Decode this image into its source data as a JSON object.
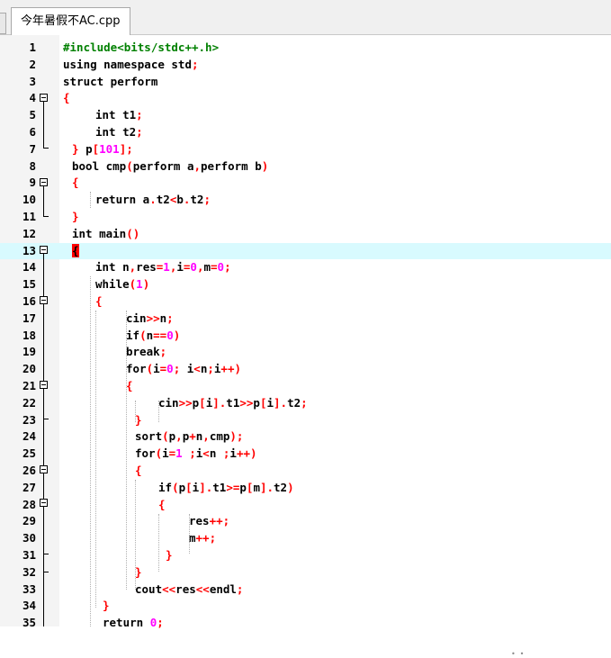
{
  "tab": {
    "title": "今年暑假不AC.cpp"
  },
  "editor": {
    "current_line": 13,
    "lines": [
      {
        "n": "1",
        "indent": 0,
        "tokens": [
          [
            "pp",
            "#include<bits/stdc++.h>"
          ]
        ]
      },
      {
        "n": "2",
        "indent": 0,
        "tokens": [
          [
            "kw",
            "using namespace std"
          ],
          [
            "op",
            ";"
          ]
        ]
      },
      {
        "n": "3",
        "indent": 0,
        "tokens": [
          [
            "kw",
            "struct perform"
          ]
        ]
      },
      {
        "n": "4",
        "indent": 0,
        "tokens": [
          [
            "op",
            "{"
          ]
        ]
      },
      {
        "n": "5",
        "indent": 36,
        "tokens": [
          [
            "kw",
            "int t1"
          ],
          [
            "op",
            ";"
          ]
        ]
      },
      {
        "n": "6",
        "indent": 36,
        "tokens": [
          [
            "kw",
            "int t2"
          ],
          [
            "op",
            ";"
          ]
        ]
      },
      {
        "n": "7",
        "indent": 10,
        "tokens": [
          [
            "op",
            "} "
          ],
          [
            "kw",
            "p"
          ],
          [
            "op",
            "["
          ],
          [
            "num",
            "101"
          ],
          [
            "op",
            "];"
          ]
        ]
      },
      {
        "n": "8",
        "indent": 10,
        "tokens": [
          [
            "kw",
            "bool cmp"
          ],
          [
            "op",
            "("
          ],
          [
            "kw",
            "perform a"
          ],
          [
            "op",
            ","
          ],
          [
            "kw",
            "perform b"
          ],
          [
            "op",
            ")"
          ]
        ]
      },
      {
        "n": "9",
        "indent": 10,
        "tokens": [
          [
            "op",
            "{"
          ]
        ]
      },
      {
        "n": "10",
        "indent": 36,
        "tokens": [
          [
            "kw",
            "return a"
          ],
          [
            "op",
            "."
          ],
          [
            "kw",
            "t2"
          ],
          [
            "op",
            "<"
          ],
          [
            "kw",
            "b"
          ],
          [
            "op",
            "."
          ],
          [
            "kw",
            "t2"
          ],
          [
            "op",
            ";"
          ]
        ]
      },
      {
        "n": "11",
        "indent": 10,
        "tokens": [
          [
            "op",
            "}"
          ]
        ]
      },
      {
        "n": "12",
        "indent": 10,
        "tokens": [
          [
            "kw",
            "int main"
          ],
          [
            "op",
            "()"
          ]
        ]
      },
      {
        "n": "13",
        "indent": 10,
        "tokens": [
          [
            "cur",
            "{"
          ]
        ]
      },
      {
        "n": "14",
        "indent": 36,
        "tokens": [
          [
            "kw",
            "int n"
          ],
          [
            "op",
            ","
          ],
          [
            "kw",
            "res"
          ],
          [
            "op",
            "="
          ],
          [
            "num",
            "1"
          ],
          [
            "op",
            ","
          ],
          [
            "kw",
            "i"
          ],
          [
            "op",
            "="
          ],
          [
            "num",
            "0"
          ],
          [
            "op",
            ","
          ],
          [
            "kw",
            "m"
          ],
          [
            "op",
            "="
          ],
          [
            "num",
            "0"
          ],
          [
            "op",
            ";"
          ]
        ]
      },
      {
        "n": "15",
        "indent": 36,
        "tokens": [
          [
            "kw",
            "while"
          ],
          [
            "op",
            "("
          ],
          [
            "num",
            "1"
          ],
          [
            "op",
            ")"
          ]
        ]
      },
      {
        "n": "16",
        "indent": 36,
        "tokens": [
          [
            "op",
            "{"
          ]
        ]
      },
      {
        "n": "17",
        "indent": 70,
        "tokens": [
          [
            "kw",
            "cin"
          ],
          [
            "op",
            ">>"
          ],
          [
            "kw",
            "n"
          ],
          [
            "op",
            ";"
          ]
        ]
      },
      {
        "n": "18",
        "indent": 70,
        "tokens": [
          [
            "kw",
            "if"
          ],
          [
            "op",
            "("
          ],
          [
            "kw",
            "n"
          ],
          [
            "op",
            "=="
          ],
          [
            "num",
            "0"
          ],
          [
            "op",
            ")"
          ]
        ]
      },
      {
        "n": "19",
        "indent": 70,
        "tokens": [
          [
            "kw",
            "break"
          ],
          [
            "op",
            ";"
          ]
        ]
      },
      {
        "n": "20",
        "indent": 70,
        "tokens": [
          [
            "kw",
            "for"
          ],
          [
            "op",
            "("
          ],
          [
            "kw",
            "i"
          ],
          [
            "op",
            "="
          ],
          [
            "num",
            "0"
          ],
          [
            "op",
            "; "
          ],
          [
            "kw",
            "i"
          ],
          [
            "op",
            "<"
          ],
          [
            "kw",
            "n"
          ],
          [
            "op",
            ";"
          ],
          [
            "kw",
            "i"
          ],
          [
            "op",
            "++)"
          ]
        ]
      },
      {
        "n": "21",
        "indent": 70,
        "tokens": [
          [
            "op",
            "{"
          ]
        ]
      },
      {
        "n": "22",
        "indent": 106,
        "tokens": [
          [
            "kw",
            "cin"
          ],
          [
            "op",
            ">>"
          ],
          [
            "kw",
            "p"
          ],
          [
            "op",
            "["
          ],
          [
            "kw",
            "i"
          ],
          [
            "op",
            "]."
          ],
          [
            "kw",
            "t1"
          ],
          [
            "op",
            ">>"
          ],
          [
            "kw",
            "p"
          ],
          [
            "op",
            "["
          ],
          [
            "kw",
            "i"
          ],
          [
            "op",
            "]."
          ],
          [
            "kw",
            "t2"
          ],
          [
            "op",
            ";"
          ]
        ]
      },
      {
        "n": "23",
        "indent": 80,
        "tokens": [
          [
            "op",
            "}"
          ]
        ]
      },
      {
        "n": "24",
        "indent": 80,
        "tokens": [
          [
            "kw",
            "sort"
          ],
          [
            "op",
            "("
          ],
          [
            "kw",
            "p"
          ],
          [
            "op",
            ","
          ],
          [
            "kw",
            "p"
          ],
          [
            "op",
            "+"
          ],
          [
            "kw",
            "n"
          ],
          [
            "op",
            ","
          ],
          [
            "kw",
            "cmp"
          ],
          [
            "op",
            ");"
          ]
        ]
      },
      {
        "n": "25",
        "indent": 80,
        "tokens": [
          [
            "kw",
            "for"
          ],
          [
            "op",
            "("
          ],
          [
            "kw",
            "i"
          ],
          [
            "op",
            "="
          ],
          [
            "num",
            "1"
          ],
          [
            "op",
            " ;"
          ],
          [
            "kw",
            "i"
          ],
          [
            "op",
            "<"
          ],
          [
            "kw",
            "n "
          ],
          [
            "op",
            ";"
          ],
          [
            "kw",
            "i"
          ],
          [
            "op",
            "++)"
          ]
        ]
      },
      {
        "n": "26",
        "indent": 80,
        "tokens": [
          [
            "op",
            "{"
          ]
        ]
      },
      {
        "n": "27",
        "indent": 106,
        "tokens": [
          [
            "kw",
            "if"
          ],
          [
            "op",
            "("
          ],
          [
            "kw",
            "p"
          ],
          [
            "op",
            "["
          ],
          [
            "kw",
            "i"
          ],
          [
            "op",
            "]."
          ],
          [
            "kw",
            "t1"
          ],
          [
            "op",
            ">="
          ],
          [
            "kw",
            "p"
          ],
          [
            "op",
            "["
          ],
          [
            "kw",
            "m"
          ],
          [
            "op",
            "]."
          ],
          [
            "kw",
            "t2"
          ],
          [
            "op",
            ")"
          ]
        ]
      },
      {
        "n": "28",
        "indent": 106,
        "tokens": [
          [
            "op",
            "{"
          ]
        ]
      },
      {
        "n": "29",
        "indent": 140,
        "tokens": [
          [
            "kw",
            "res"
          ],
          [
            "op",
            "++;"
          ]
        ]
      },
      {
        "n": "30",
        "indent": 140,
        "tokens": [
          [
            "kw",
            "m"
          ],
          [
            "op",
            "++;"
          ]
        ]
      },
      {
        "n": "31",
        "indent": 114,
        "tokens": [
          [
            "op",
            "}"
          ]
        ]
      },
      {
        "n": "32",
        "indent": 80,
        "tokens": [
          [
            "op",
            "}"
          ]
        ]
      },
      {
        "n": "33",
        "indent": 80,
        "tokens": [
          [
            "kw",
            "cout"
          ],
          [
            "op",
            "<<"
          ],
          [
            "kw",
            "res"
          ],
          [
            "op",
            "<<"
          ],
          [
            "kw",
            "endl"
          ],
          [
            "op",
            ";"
          ]
        ]
      },
      {
        "n": "34",
        "indent": 44,
        "tokens": [
          [
            "op",
            "}"
          ]
        ]
      },
      {
        "n": "35",
        "indent": 44,
        "tokens": [
          [
            "kw",
            "return "
          ],
          [
            "num",
            "0"
          ],
          [
            "op",
            ";"
          ]
        ]
      }
    ]
  },
  "colors": {
    "current_line_bg": "#d8fafe",
    "preprocessor": "#008000",
    "operator": "#ff0000",
    "number": "#ff00ff",
    "keyword": "#000000"
  }
}
